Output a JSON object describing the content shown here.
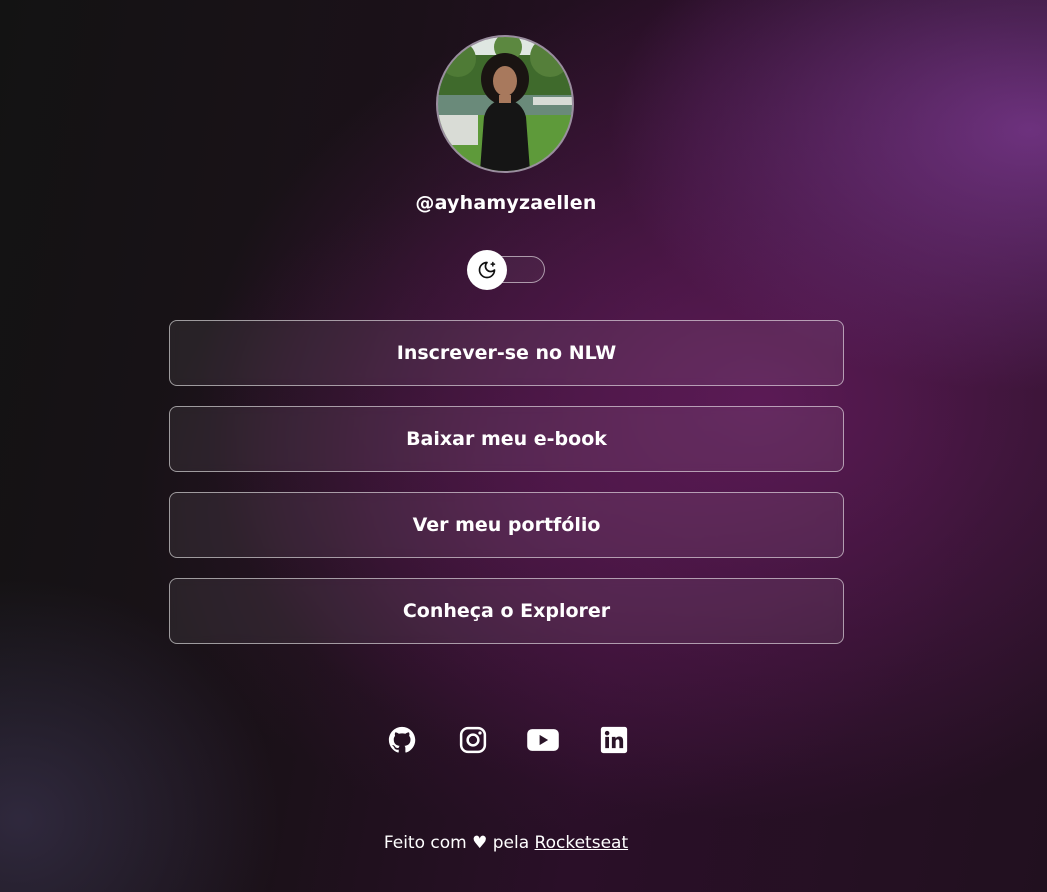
{
  "profile": {
    "username": "@ayhamyzaellen",
    "avatar_icon": "profile-photo"
  },
  "theme_switch": {
    "icon": "moon-stars-icon",
    "mode": "dark"
  },
  "links": [
    {
      "label": "Inscrever-se no NLW"
    },
    {
      "label": "Baixar meu e-book"
    },
    {
      "label": "Ver meu portfólio"
    },
    {
      "label": "Conheça o Explorer"
    }
  ],
  "social": [
    {
      "icon": "github-icon"
    },
    {
      "icon": "instagram-icon"
    },
    {
      "icon": "youtube-icon"
    },
    {
      "icon": "linkedin-icon"
    }
  ],
  "footer": {
    "prefix": "Feito com ♥ pela ",
    "link_label": "Rocketseat"
  },
  "colors": {
    "text": "#ffffff",
    "accent_purple": "#5c2a6e",
    "background_dark": "#151215"
  }
}
